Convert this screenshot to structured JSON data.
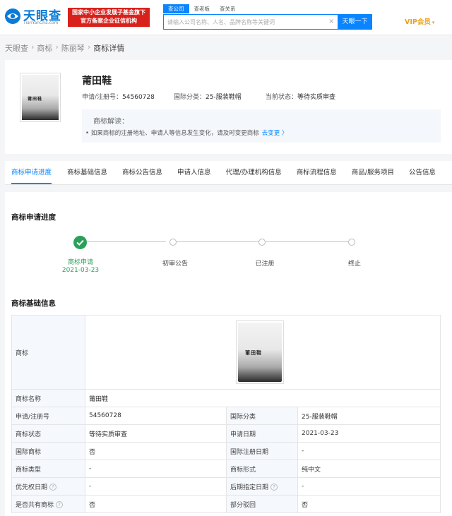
{
  "header": {
    "logo_name": "天眼查",
    "logo_sub": "TianYanCha.com",
    "gov_badge_line1": "国家中小企业发展子基金旗下",
    "gov_badge_line2": "官方备案企业征信机构",
    "search_tabs": [
      "查公司",
      "查老板",
      "查关系"
    ],
    "search_placeholder": "请输入公司名称、人名、品牌名称等关键词",
    "search_button": "天眼一下",
    "vip_label": "VIP会员"
  },
  "breadcrumb": [
    "天眼查",
    "商标",
    "陈丽琴",
    "商标详情"
  ],
  "trademark": {
    "name": "莆田鞋",
    "image_text": "莆田鞋",
    "reg_no_label": "申请/注册号：",
    "reg_no": "54560728",
    "class_label": "国际分类：",
    "class_value": "25-服装鞋帽",
    "status_label": "当前状态：",
    "status_value": "等待实质审查",
    "interp_title": "商标解读：",
    "interp_text": "• 如果商标的注册地址、申请人等信息发生变化，请及时变更商标",
    "interp_link": "去变更 〉"
  },
  "tabs": [
    "商标申请进度",
    "商标基础信息",
    "商标公告信息",
    "申请人信息",
    "代理/办理机构信息",
    "商标流程信息",
    "商品/服务项目",
    "公告信息"
  ],
  "progress": {
    "title": "商标申请进度",
    "steps": [
      {
        "label": "商标申请",
        "date": "2021-03-23",
        "done": true
      },
      {
        "label": "初审公告",
        "done": false
      },
      {
        "label": "已注册",
        "done": false
      },
      {
        "label": "终止",
        "done": false
      }
    ]
  },
  "basic": {
    "title": "商标基础信息",
    "image_label": "商标",
    "name_label": "商标名称",
    "name_value": "莆田鞋",
    "rows": [
      {
        "l1": "申请/注册号",
        "v1": "54560728",
        "l2": "国际分类",
        "v2": "25-服装鞋帽"
      },
      {
        "l1": "商标状态",
        "v1": "等待实质审查",
        "l2": "申请日期",
        "v2": "2021-03-23"
      },
      {
        "l1": "国际商标",
        "v1": "否",
        "l2": "国际注册日期",
        "v2": "-"
      },
      {
        "l1": "商标类型",
        "v1": "-",
        "l2": "商标形式",
        "v2": "纯中文"
      },
      {
        "l1": "优先权日期",
        "v1": "-",
        "l2": "后期指定日期",
        "v2": "-"
      },
      {
        "l1": "是否共有商标",
        "v1": "否",
        "l2": "部分驳回",
        "v2": "否"
      }
    ]
  },
  "colors": {
    "brand": "#0a84ff",
    "success": "#2aa05a",
    "vip": "#e8a21e",
    "badge": "#d9211c"
  }
}
